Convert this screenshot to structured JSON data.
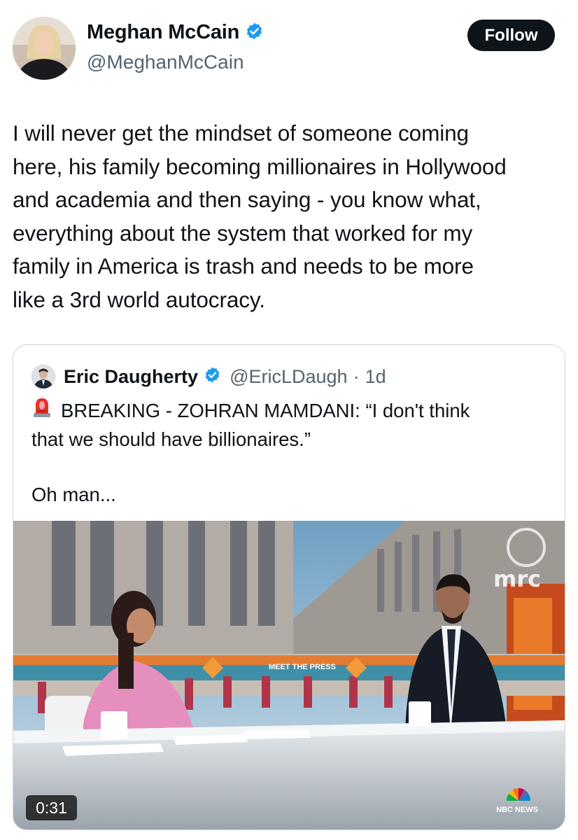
{
  "author": {
    "name": "Meghan McCain",
    "handle": "@MeghanMcCain",
    "verified": true,
    "avatar_icon": "profile-photo"
  },
  "follow_button": {
    "label": "Follow"
  },
  "tweet": {
    "text": "I will never get the mindset of someone coming\nhere, his family becoming millionaires in Hollywood\nand academia and then saying - you know what,\neverything about the system that worked for my\nfamily in America is trash and needs to be more\nlike a 3rd world autocracy."
  },
  "quoted": {
    "name": "Eric Daugherty",
    "verified": true,
    "handle": "@EricLDaugh",
    "separator": "·",
    "time": "1d",
    "siren_icon": "rotating-light-icon",
    "text_line1": "BREAKING - ZOHRAN MAMDANI: “I don't think",
    "text_line2": "that we should have billionaires.”",
    "text_extra": "Oh man...",
    "video": {
      "duration": "0:31",
      "watermark": "mrc",
      "network_logo": "NBC NEWS",
      "desk_logo": "MEET THE PRESS"
    }
  },
  "colors": {
    "verified_blue": "#1d9bf0",
    "follow_bg": "#0f1419",
    "secondary_text": "#536471",
    "border": "#cfd9de"
  }
}
